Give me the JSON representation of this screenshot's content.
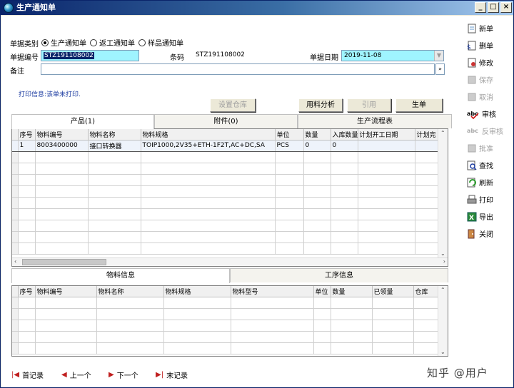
{
  "window": {
    "title": "生产通知单"
  },
  "form": {
    "doc_type_label": "单据类别",
    "doc_type_options": [
      "生产通知单",
      "返工通知单",
      "样品通知单"
    ],
    "doc_type_selected": 0,
    "doc_no_label": "单据编号",
    "doc_no_value": "STZ191108002",
    "barcode_label": "条码",
    "barcode_value": "STZ191108002",
    "doc_date_label": "单据日期",
    "doc_date_value": "2019-11-08",
    "remark_label": "备注",
    "remark_value": "",
    "print_info": "打印信息:该单未打印."
  },
  "buttons": {
    "set_warehouse": "设置仓库",
    "material_analysis": "用料分析",
    "reference": "引用",
    "generate": "生单"
  },
  "top_tabs": [
    "产品(1)",
    "附件(0)",
    "生产流程表"
  ],
  "product_grid": {
    "columns": [
      "序号",
      "物料编号",
      "物料名称",
      "物料规格",
      "单位",
      "数量",
      "入库数量",
      "计划开工日期",
      "计划完"
    ],
    "rows": [
      [
        "1",
        "8003400000",
        "接口转换器",
        "TOIP1000,2V35+ETH-1F2T,AC+DC,SA",
        "PCS",
        "0",
        "0",
        "",
        ""
      ]
    ]
  },
  "bottom_tabs": [
    "物料信息",
    "工序信息"
  ],
  "material_grid": {
    "columns": [
      "序号",
      "物料编号",
      "物料名称",
      "物料规格",
      "物料型号",
      "单位",
      "数量",
      "已领量",
      "仓库"
    ]
  },
  "toolbar": [
    "新单",
    "删单",
    "修改",
    "保存",
    "取消",
    "审核",
    "反审核",
    "批准",
    "查找",
    "刷新",
    "打印",
    "导出",
    "关闭"
  ],
  "nav": [
    "首记录",
    "上一个",
    "下一个",
    "末记录"
  ],
  "watermark": "知乎 @用户"
}
